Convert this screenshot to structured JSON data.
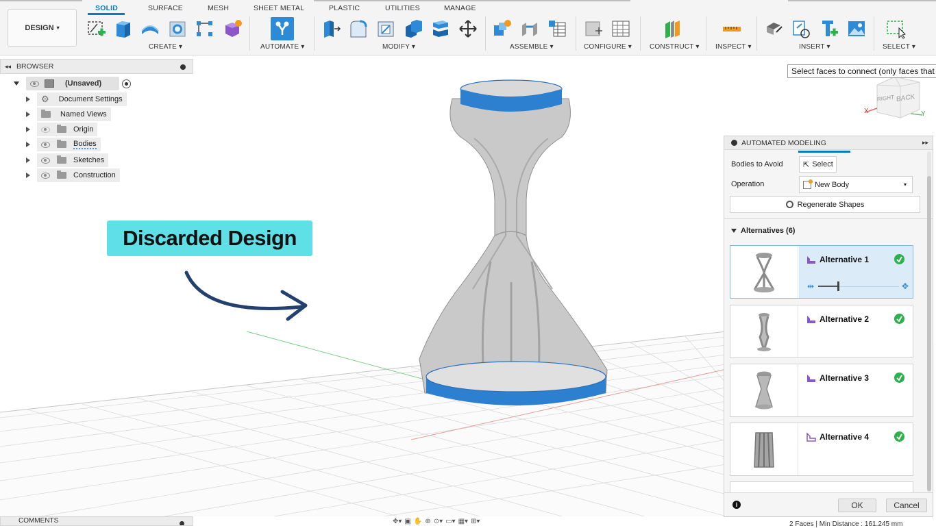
{
  "toolbar": {
    "workspace_label": "DESIGN",
    "tabs": [
      "SOLID",
      "SURFACE",
      "MESH",
      "SHEET METAL",
      "PLASTIC",
      "UTILITIES",
      "MANAGE"
    ],
    "groups": [
      "CREATE",
      "AUTOMATE",
      "MODIFY",
      "ASSEMBLE",
      "CONFIGURE",
      "CONSTRUCT",
      "INSPECT",
      "INSERT",
      "SELECT"
    ],
    "accent": "#0a78c8"
  },
  "browser": {
    "title": "BROWSER",
    "root_label": "(Unsaved)",
    "items": [
      "Document Settings",
      "Named Views",
      "Origin",
      "Bodies",
      "Sketches",
      "Construction"
    ]
  },
  "comments": {
    "title": "COMMENTS"
  },
  "tooltip": "Select faces to connect (only faces that",
  "viewcube": {
    "right": "RIGHT",
    "back": "BACK",
    "x": "X",
    "y": "Y"
  },
  "callout": {
    "text": "Discarded Design",
    "color": "#5ee0e6"
  },
  "panel": {
    "title": "AUTOMATED MODELING",
    "bodies_to_avoid_label": "Bodies to Avoid",
    "select_label": "Select",
    "operation_label": "Operation",
    "operation_value": "New Body",
    "regenerate_label": "Regenerate Shapes",
    "alternatives_header": "Alternatives (6)",
    "alternatives": [
      "Alternative 1",
      "Alternative 2",
      "Alternative 3",
      "Alternative 4"
    ],
    "ok_label": "OK",
    "cancel_label": "Cancel"
  },
  "status_bar": {
    "right_text": "2 Faces | Min Distance : 161.245 mm"
  }
}
